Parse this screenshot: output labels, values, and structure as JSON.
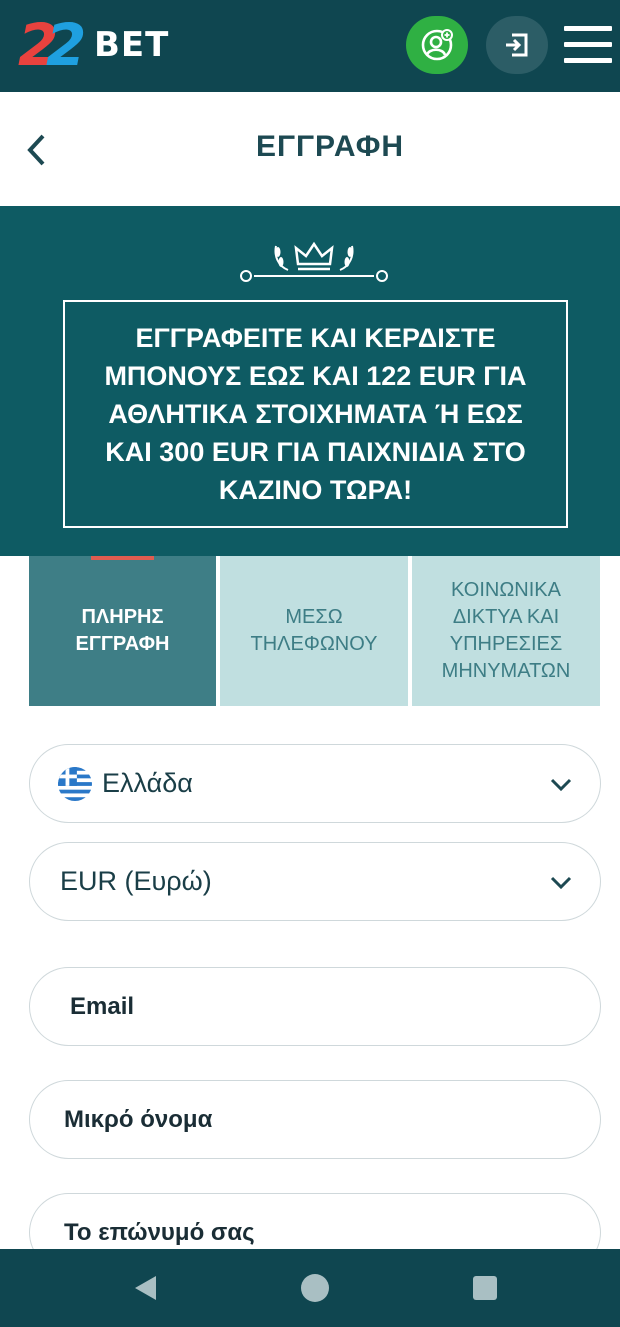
{
  "header": {
    "logo_digits": "22",
    "logo_word": "BET",
    "colors": {
      "bar": "#0f4650",
      "register_button": "#2fb043",
      "login_button": "#2c5d66"
    },
    "icons": [
      "add-user-icon",
      "login-icon",
      "hamburger-menu-icon"
    ]
  },
  "title_bar": {
    "title": "ΕΓΓΡΑΦΗ",
    "back_icon": "chevron-left-icon"
  },
  "banner": {
    "promo_text": "ΕΓΓΡΑΦΕΙΤΕ ΚΑΙ ΚΕΡΔΙΣΤΕ ΜΠΟΝΟΥΣ ΕΩΣ ΚΑΙ 122 EUR ΓΙΑ ΑΘΛΗΤΙΚΑ ΣΤΟΙΧΗΜΑΤΑ Ή ΕΩΣ ΚΑΙ 300 EUR ΓΙΑ ΠΑΙΧΝΙΔΙΑ ΣΤΟ ΚΑΖΙΝΟ ΤΩΡΑ!",
    "background": "#0e5b63"
  },
  "tabs": [
    {
      "label": "ΠΛΗΡΗΣ\nΕΓΓΡΑΦΗ",
      "active": true
    },
    {
      "label": "ΜΕΣΩ\nΤΗΛΕΦΩΝΟΥ",
      "active": false
    },
    {
      "label": "ΚΟΙΝΩΝΙΚΑ\nΔΙΚΤΥΑ ΚΑΙ\nΥΠΗΡΕΣΙΕΣ\nΜΗΝΥΜΑΤΩΝ",
      "active": false
    }
  ],
  "form": {
    "country": {
      "value": "Ελλάδα",
      "flag": "greece-flag-icon"
    },
    "currency": {
      "value": "EUR (Ευρώ)"
    },
    "email": {
      "placeholder": "Email"
    },
    "first_name": {
      "placeholder": "Μικρό όνομα"
    },
    "last_name": {
      "placeholder": "Το επώνυμό σας"
    }
  },
  "system_nav": {
    "icons": [
      "back-triangle-icon",
      "home-circle-icon",
      "recents-square-icon"
    ]
  }
}
